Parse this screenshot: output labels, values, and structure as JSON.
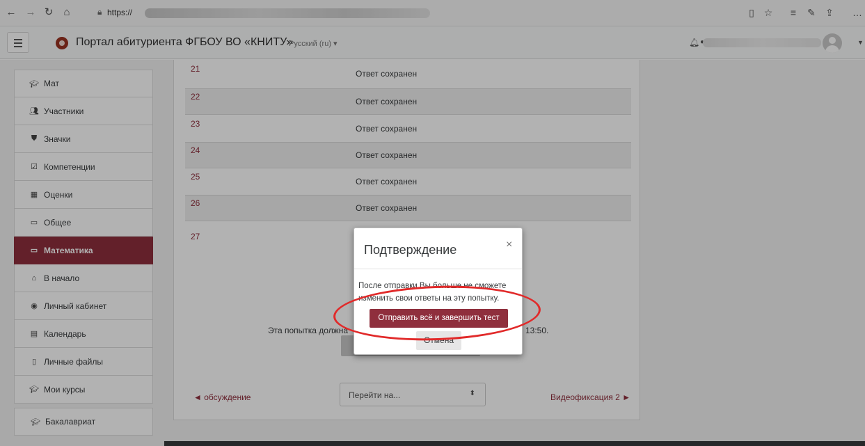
{
  "browser": {
    "url_prefix": "https://",
    "icons": [
      "back-icon",
      "forward-icon",
      "refresh-icon",
      "home-icon",
      "lock-icon",
      "reading-view-icon",
      "favorite-star-icon",
      "favorites-list-icon",
      "pen-icon",
      "share-icon",
      "more-icon"
    ]
  },
  "header": {
    "site_title": "Портал абитуриента ФГБОУ ВО «КНИТУ»",
    "language": "Русский (ru) ▾"
  },
  "sidebar": {
    "items": [
      {
        "label": "Мат",
        "icon": "graduation-cap-icon"
      },
      {
        "label": "Участники",
        "icon": "users-icon"
      },
      {
        "label": "Значки",
        "icon": "shield-icon"
      },
      {
        "label": "Компетенции",
        "icon": "checkbox-icon"
      },
      {
        "label": "Оценки",
        "icon": "table-icon"
      },
      {
        "label": "Общее",
        "icon": "folder-icon"
      },
      {
        "label": "Математика",
        "icon": "folder-icon",
        "active": true
      },
      {
        "label": "В начало",
        "icon": "home-icon"
      },
      {
        "label": "Личный кабинет",
        "icon": "dashboard-icon"
      },
      {
        "label": "Календарь",
        "icon": "calendar-icon"
      },
      {
        "label": "Личные файлы",
        "icon": "file-icon"
      },
      {
        "label": "Мои курсы",
        "icon": "graduation-cap-icon"
      }
    ],
    "extra_item": {
      "label": "Бакалавриат",
      "icon": "graduation-cap-icon"
    }
  },
  "summary": {
    "rows": [
      {
        "num": "21",
        "status": "Ответ сохранен"
      },
      {
        "num": "22",
        "status": "Ответ сохранен"
      },
      {
        "num": "23",
        "status": "Ответ сохранен"
      },
      {
        "num": "24",
        "status": "Ответ сохранен"
      },
      {
        "num": "25",
        "status": "Ответ сохранен"
      },
      {
        "num": "26",
        "status": "Ответ сохранен"
      },
      {
        "num": "27",
        "status": ""
      }
    ],
    "due_text": "Эта попытка должна",
    "due_time": "13:50."
  },
  "navigation": {
    "prev_label": "◄ обсуждение",
    "jump_placeholder": "Перейти на...",
    "next_label": "Видеофиксация 2 ►"
  },
  "modal": {
    "title": "Подтверждение",
    "close": "×",
    "body": "После отправки Вы больше не сможете изменить свои ответы на эту попытку.",
    "submit_label": "Отправить всё и завершить тест",
    "cancel_label": "Отмена"
  },
  "colors": {
    "brand": "#8f2f3d",
    "annotation": "#e12a2a"
  }
}
